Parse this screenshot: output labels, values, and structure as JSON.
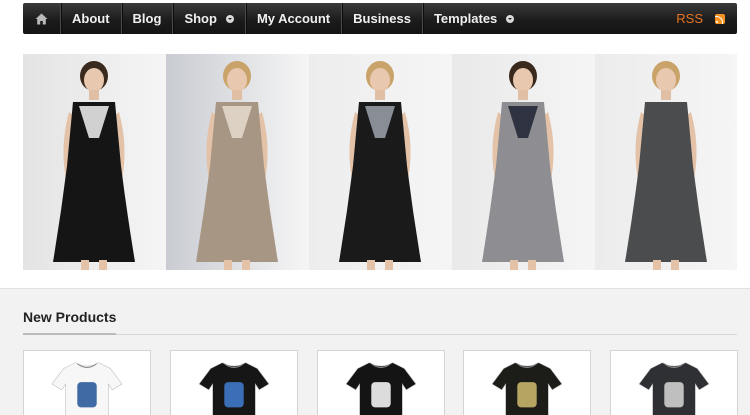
{
  "nav": {
    "home_icon": "home-icon",
    "items": [
      {
        "label": "About",
        "dropdown": false
      },
      {
        "label": "Blog",
        "dropdown": false
      },
      {
        "label": "Shop",
        "dropdown": true
      },
      {
        "label": "My Account",
        "dropdown": false
      },
      {
        "label": "Business",
        "dropdown": false
      },
      {
        "label": "Templates",
        "dropdown": true
      }
    ],
    "rss_label": "RSS",
    "rss_icon": "rss-feed-icon"
  },
  "banner": {
    "panels": [
      {
        "icon": "model-photo",
        "dress_color": "#151515",
        "accent_color": "#f2f2f2"
      },
      {
        "icon": "model-photo",
        "dress_color": "#a89684",
        "accent_color": "#e6dccf"
      },
      {
        "icon": "model-photo",
        "dress_color": "#1a1a1a",
        "accent_color": "#9da3ad"
      },
      {
        "icon": "model-photo",
        "dress_color": "#8e8e92",
        "accent_color": "#1d2233"
      },
      {
        "icon": "model-photo",
        "dress_color": "#4a4c4e",
        "accent_color": "#4a4c4e"
      }
    ]
  },
  "products": {
    "title": "New Products",
    "items": [
      {
        "icon": "white-tshirt-bear-print",
        "shirt_color": "#f7f7f7",
        "print_color": "#2a5a9a"
      },
      {
        "icon": "black-tshirt-guitar-print",
        "shirt_color": "#161616",
        "print_color": "#3e78c8"
      },
      {
        "icon": "black-tshirt-peace-print",
        "shirt_color": "#141414",
        "print_color": "#f2f2f2"
      },
      {
        "icon": "black-tshirt-graphic-print",
        "shirt_color": "#1c1c18",
        "print_color": "#c8b46a"
      },
      {
        "icon": "grey-tshirt-band-print",
        "shirt_color": "#2f3033",
        "print_color": "#cfcfcf"
      }
    ]
  }
}
